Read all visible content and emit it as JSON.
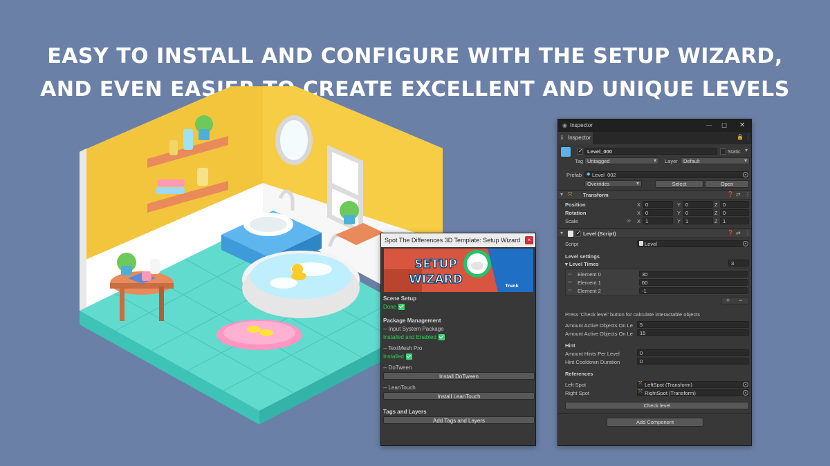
{
  "headline": {
    "line1": "EASY TO INSTALL AND CONFIGURE WITH THE SETUP WIZARD,",
    "line2": "AND EVEN EASIER TO CREATE EXCELLENT AND UNIQUE LEVELS"
  },
  "colors": {
    "background": "#6b80a6",
    "wall_yellow": "#f0c23d",
    "floor_teal": "#58d6c9",
    "editor_dark": "#383838",
    "success_green": "#29d35a",
    "close_red": "#c8323a"
  },
  "wizard": {
    "title": "Spot The Differences 3D Template: Setup Wizard",
    "close_label": "×",
    "banner": {
      "line1": "SETUP",
      "line2": "WIZARD",
      "badge": "Trunk"
    },
    "scene_setup": {
      "heading": "Scene Setup",
      "status": "Done"
    },
    "package_management": {
      "heading": "Package Management",
      "input_system": {
        "name": "-- Input System Package",
        "status": "Installed and Enabled"
      },
      "textmesh": {
        "name": "-- TextMesh Pro",
        "status": "Installed"
      },
      "dotween": {
        "name": "-- DoTween",
        "button": "Install DoTween"
      },
      "leantouch": {
        "name": "-- LeanTouch",
        "button": "Install LeanTouch"
      }
    },
    "tags_layers": {
      "heading": "Tags and Layers",
      "button": "Add Tags and Layers"
    }
  },
  "inspector": {
    "window_title": "Inspector",
    "tab_label": "Inspector",
    "object": {
      "name": "Level_000",
      "static_label": "Static",
      "tag_label": "Tag",
      "tag_value": "Untagged",
      "layer_label": "Layer",
      "layer_value": "Default",
      "prefab_label": "Prefab",
      "prefab_value": "Level_002",
      "overrides": "Overrides",
      "select": "Select",
      "open": "Open"
    },
    "transform": {
      "title": "Transform",
      "rows": [
        {
          "label": "Position",
          "x": "0",
          "y": "0",
          "z": "0"
        },
        {
          "label": "Rotation",
          "x": "0",
          "y": "0",
          "z": "0"
        },
        {
          "label": "Scale",
          "x": "1",
          "y": "1",
          "z": "1"
        }
      ]
    },
    "level_script": {
      "title": "Level (Script)",
      "script_label": "Script",
      "script_value": "Level",
      "level_settings": "Level settings",
      "level_times_label": "Level Times",
      "level_times_count": "3",
      "elements": [
        {
          "label": "Element 0",
          "value": "30"
        },
        {
          "label": "Element 1",
          "value": "60"
        },
        {
          "label": "Element 2",
          "value": "-1"
        }
      ],
      "add_label": "+",
      "remove_label": "−",
      "check_hint": "Press 'Check level' button for calculate interactable objects",
      "active_objects_1": {
        "label": "Amount Active Objects On Le",
        "value": "5"
      },
      "active_objects_2": {
        "label": "Amount Active Objects On Le",
        "value": "15"
      },
      "hint_heading": "Hint",
      "hints_per_level": {
        "label": "Amount Hints Per Level",
        "value": "0"
      },
      "hint_cooldown": {
        "label": "Hint Cooldown Duration",
        "value": "0"
      },
      "references_heading": "References",
      "left_spot": {
        "label": "Left Spot",
        "value": "LeftSpot (Transform)"
      },
      "right_spot": {
        "label": "Right Spot",
        "value": "RightSpot (Transform)"
      },
      "check_level": "Check level"
    },
    "add_component": "Add Component"
  }
}
